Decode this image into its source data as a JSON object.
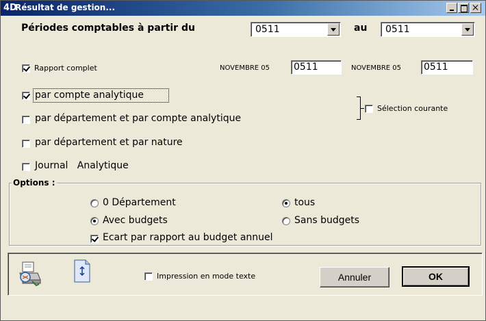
{
  "window": {
    "title": "Résultat de gestion..."
  },
  "periods": {
    "label": "Périodes comptables à partir du",
    "from_value": "0511",
    "to_label": "au",
    "to_value": "0511"
  },
  "rapport_complet": {
    "label": "Rapport complet",
    "checked": true
  },
  "from_date": {
    "month_label": "NOVEMBRE 05",
    "value": "0511"
  },
  "to_date": {
    "month_label": "NOVEMBRE 05",
    "value": "0511"
  },
  "options_list": {
    "par_compte": {
      "label": "par compte analytique",
      "checked": true
    },
    "par_dept_compte": {
      "label": "par département et par compte analytique",
      "checked": false
    },
    "par_dept_nature": {
      "label": "par département et par nature",
      "checked": false
    },
    "journal": {
      "label": "Journal   Analytique",
      "checked": false
    }
  },
  "selection_courante": {
    "label": "Sélection courante",
    "checked": false
  },
  "options_group": {
    "title": "Options :",
    "zero_departement": {
      "label": "0 Département",
      "selected": false
    },
    "tous": {
      "label": "tous",
      "selected": true
    },
    "avec_budgets": {
      "label": "Avec budgets",
      "selected": true
    },
    "sans_budgets": {
      "label": "Sans budgets",
      "selected": false
    },
    "ecart": {
      "label": "Ecart par rapport au budget annuel",
      "checked": true
    }
  },
  "footer": {
    "impression_texte": {
      "label": "Impression en mode texte",
      "checked": false
    },
    "annuler_label": "Annuler",
    "ok_label": "OK"
  },
  "colors": {
    "titlebar_start": "#0a246a",
    "titlebar_end": "#a6caf0",
    "dialog_bg": "#ece9d8"
  },
  "icons": {
    "printer": "printer-icon",
    "document": "document-icon"
  }
}
